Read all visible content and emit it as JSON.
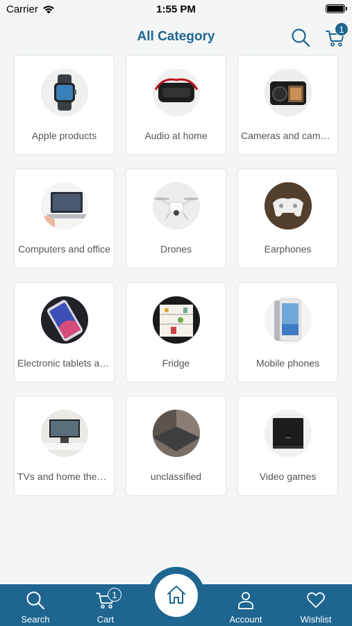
{
  "status_bar": {
    "carrier": "Carrier",
    "time": "1:55 PM"
  },
  "header": {
    "title": "All Category",
    "cart_count": "1"
  },
  "categories": [
    {
      "label": "Apple products",
      "icon": "smartwatch"
    },
    {
      "label": "Audio at home",
      "icon": "vr-headset"
    },
    {
      "label": "Cameras and camcorders",
      "icon": "camera"
    },
    {
      "label": "Computers and office",
      "icon": "laptop"
    },
    {
      "label": "Drones",
      "icon": "drone"
    },
    {
      "label": "Earphones",
      "icon": "gamepad"
    },
    {
      "label": "Electronic tablets and accessories",
      "icon": "tablet"
    },
    {
      "label": "Fridge",
      "icon": "fridge"
    },
    {
      "label": "Mobile phones",
      "icon": "phone"
    },
    {
      "label": "TVs and home theater",
      "icon": "tv"
    },
    {
      "label": "unclassified",
      "icon": "laptop-closed"
    },
    {
      "label": "Video games",
      "icon": "console"
    }
  ],
  "bottom_nav": {
    "search": "Search",
    "cart": "Cart",
    "cart_count": "1",
    "account": "Account",
    "wishlist": "Wishlist"
  },
  "colors": {
    "primary": "#1e6590",
    "background": "#f4f6f6"
  }
}
